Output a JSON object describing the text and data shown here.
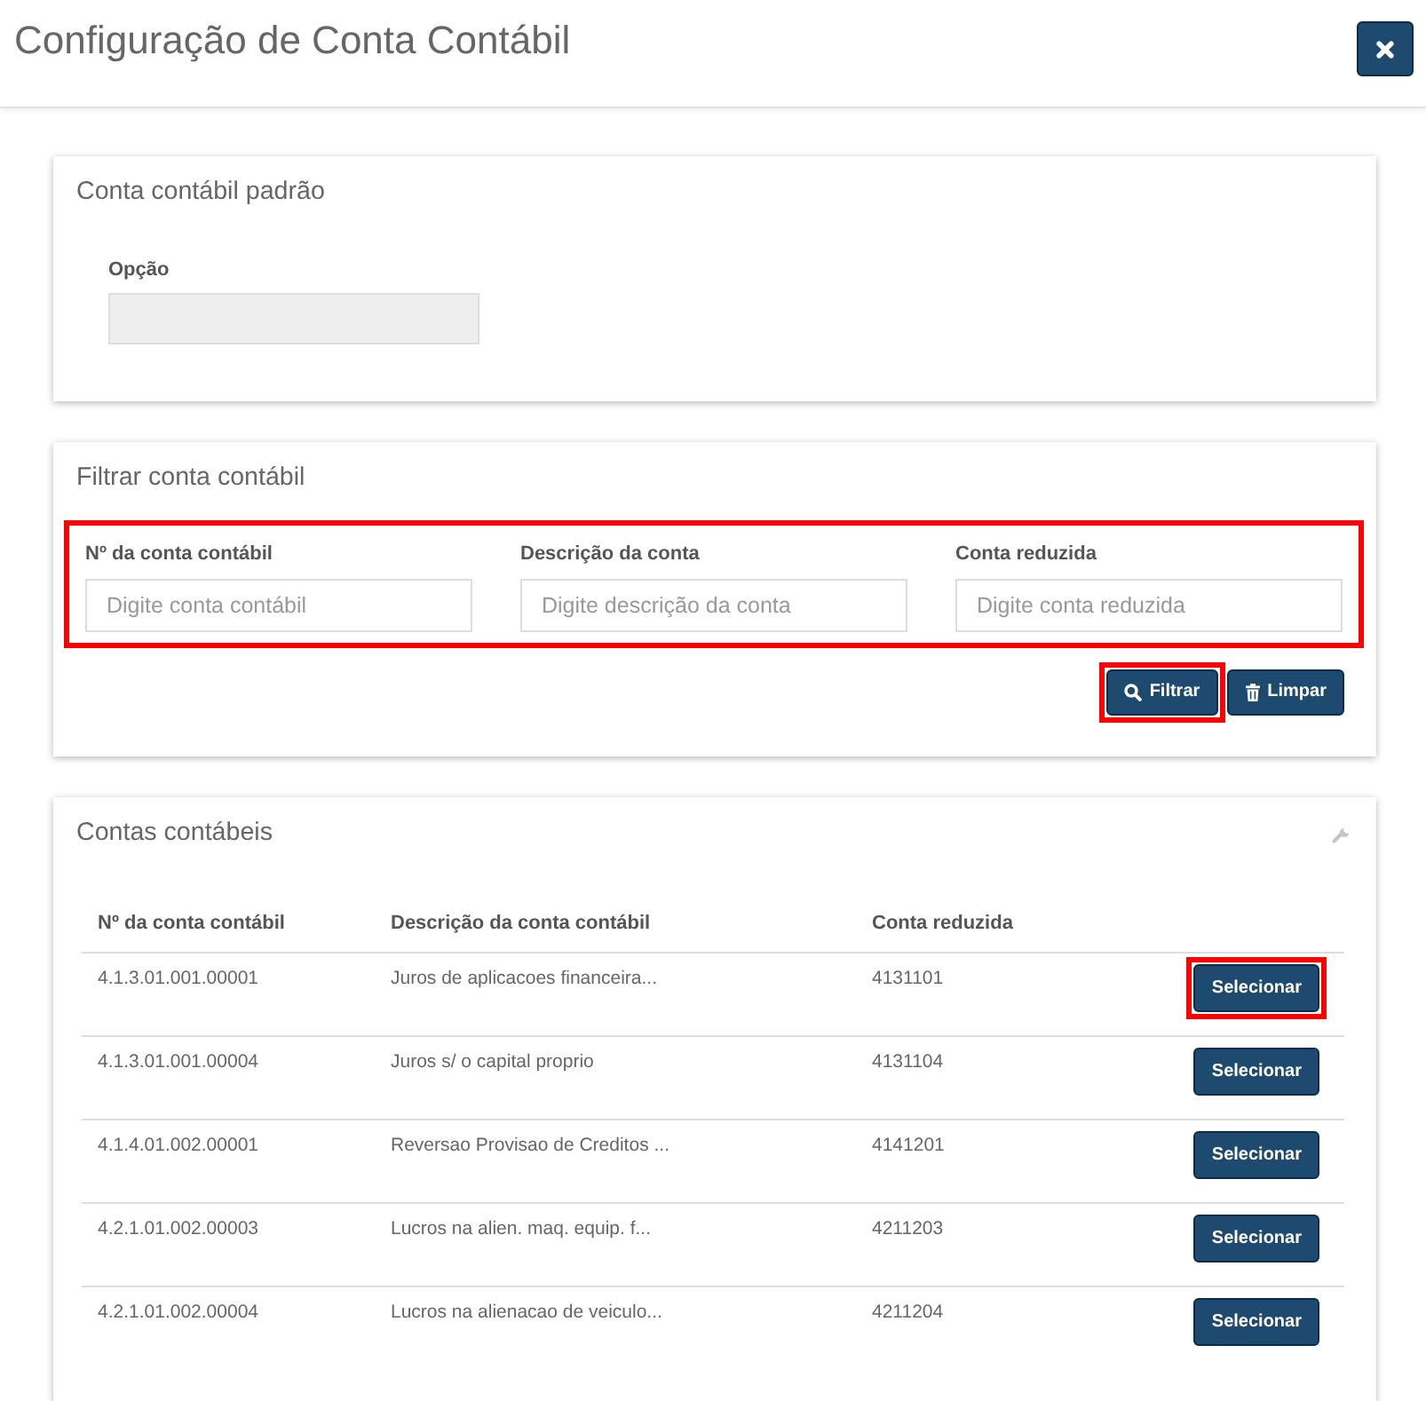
{
  "header": {
    "title": "Configuração de Conta Contábil"
  },
  "default_account": {
    "title": "Conta contábil padrão",
    "field": {
      "label": "Opção",
      "disabled": true
    }
  },
  "filter": {
    "title": "Filtrar conta contábil",
    "highlighted": true,
    "fields": [
      {
        "label": "Nº da conta contábil",
        "placeholder": "Digite conta contábil"
      },
      {
        "label": "Descrição da conta",
        "placeholder": "Digite descrição da conta"
      },
      {
        "label": "Conta reduzida",
        "placeholder": "Digite conta reduzida"
      }
    ],
    "buttons": [
      {
        "kind": "filter",
        "label": "Filtrar",
        "highlighted": true
      },
      {
        "kind": "clear",
        "label": "Limpar",
        "highlighted": false
      }
    ]
  },
  "accounts": {
    "title": "Contas contábeis",
    "columns": [
      "Nº da conta contábil",
      "Descrição da conta contábil",
      "Conta reduzida"
    ],
    "rows": [
      {
        "number": "4.1.3.01.001.00001",
        "description": "Juros de aplicacoes financeira...",
        "reduced": "4131101",
        "button": "Selecionar",
        "highlighted": true
      },
      {
        "number": "4.1.3.01.001.00004",
        "description": "Juros s/ o capital proprio",
        "reduced": "4131104",
        "button": "Selecionar",
        "highlighted": false
      },
      {
        "number": "4.1.4.01.002.00001",
        "description": "Reversao Provisao de Creditos ...",
        "reduced": "4141201",
        "button": "Selecionar",
        "highlighted": false
      },
      {
        "number": "4.2.1.01.002.00003",
        "description": "Lucros na alien. maq. equip. f...",
        "reduced": "4211203",
        "button": "Selecionar",
        "highlighted": false
      },
      {
        "number": "4.2.1.01.002.00004",
        "description": "Lucros na alienacao de veiculo...",
        "reduced": "4211204",
        "button": "Selecionar",
        "highlighted": false
      }
    ]
  }
}
